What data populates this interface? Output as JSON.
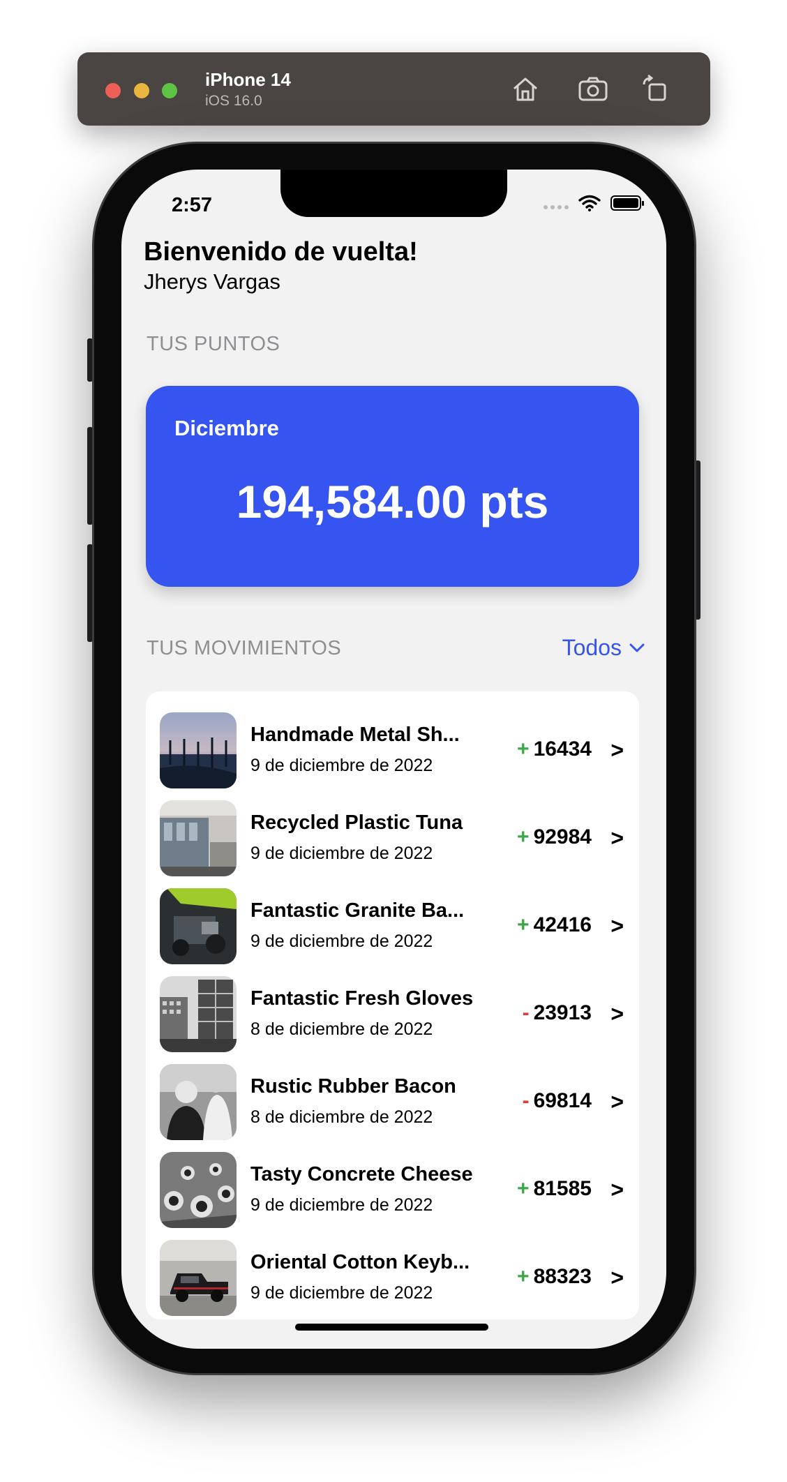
{
  "simulator": {
    "device_name": "iPhone 14",
    "os_version": "iOS 16.0",
    "buttons": [
      "home-icon",
      "screenshot-icon",
      "rotate-icon"
    ]
  },
  "status_bar": {
    "time": "2:57"
  },
  "header": {
    "welcome": "Bienvenido de vuelta!",
    "username": "Jherys Vargas"
  },
  "points": {
    "section_label": "TUS PUNTOS",
    "month": "Diciembre",
    "value": "194,584.00 pts",
    "card_color": "#3654f0"
  },
  "movements": {
    "section_label": "TUS MOVIMIENTOS",
    "filter_label": "Todos",
    "accent_color": "#3654f0",
    "positive_color": "#3aa847",
    "negative_color": "#e53935",
    "items": [
      {
        "title": "Handmade Metal Sh...",
        "date": "9 de diciembre de 2022",
        "sign": "+",
        "amount": "16434",
        "chevron": ">",
        "thumb": "gondolas-venice-photo"
      },
      {
        "title": "Recycled Plastic Tuna",
        "date": "9 de diciembre de 2022",
        "sign": "+",
        "amount": "92984",
        "chevron": ">",
        "thumb": "train-platform-photo"
      },
      {
        "title": "Fantastic Granite Ba...",
        "date": "9 de diciembre de 2022",
        "sign": "+",
        "amount": "42416",
        "chevron": ">",
        "thumb": "machinery-photo"
      },
      {
        "title": "Fantastic Fresh Gloves",
        "date": "8 de diciembre de 2022",
        "sign": "-",
        "amount": "23913",
        "chevron": ">",
        "thumb": "city-buildings-photo"
      },
      {
        "title": "Rustic Rubber Bacon",
        "date": "8 de diciembre de 2022",
        "sign": "-",
        "amount": "69814",
        "chevron": ">",
        "thumb": "people-bw-photo"
      },
      {
        "title": "Tasty Concrete Cheese",
        "date": "9 de diciembre de 2022",
        "sign": "+",
        "amount": "81585",
        "chevron": ">",
        "thumb": "motorcycles-bw-photo"
      },
      {
        "title": "Oriental Cotton Keyb...",
        "date": "9 de diciembre de 2022",
        "sign": "+",
        "amount": "88323",
        "chevron": ">",
        "thumb": "pickup-truck-photo"
      }
    ]
  }
}
